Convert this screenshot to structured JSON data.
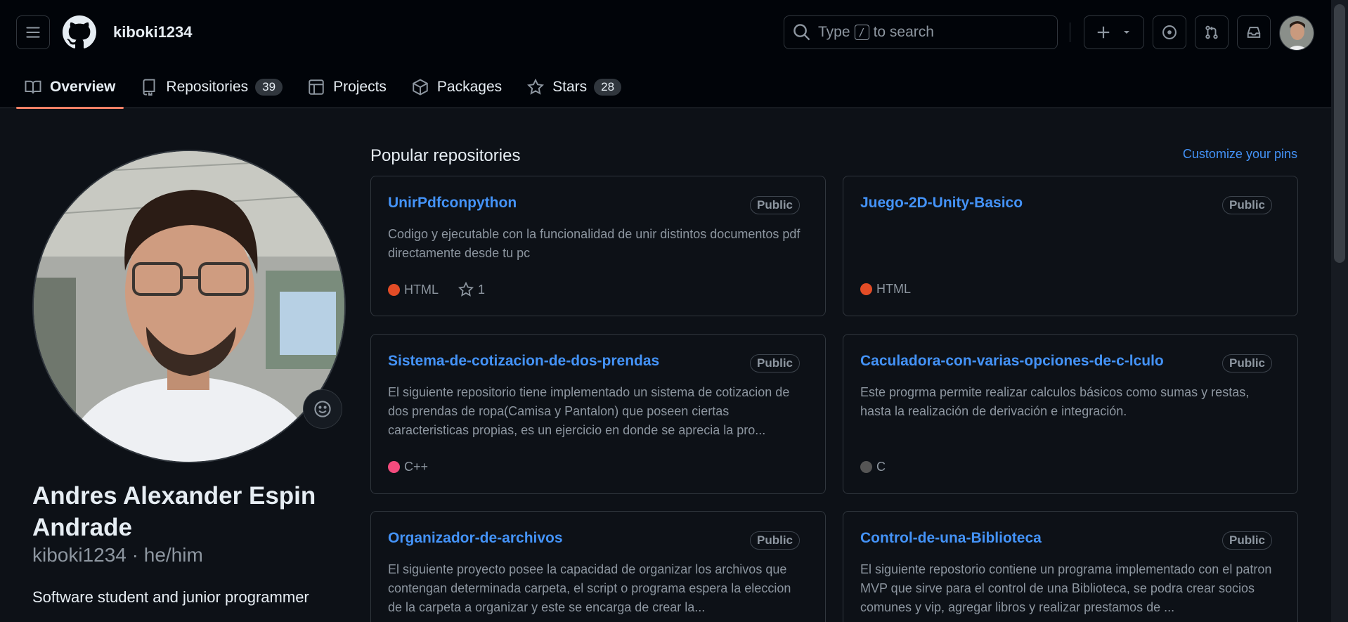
{
  "header": {
    "username": "kiboki1234",
    "search": {
      "prefix": "Type",
      "key": "/",
      "suffix": "to search"
    }
  },
  "tabs": [
    {
      "label": "Overview",
      "icon": "book-icon"
    },
    {
      "label": "Repositories",
      "icon": "repo-icon",
      "count": "39"
    },
    {
      "label": "Projects",
      "icon": "table-icon"
    },
    {
      "label": "Packages",
      "icon": "package-icon"
    },
    {
      "label": "Stars",
      "icon": "star-icon",
      "count": "28"
    }
  ],
  "profile": {
    "full_name": "Andres Alexander Espin Andrade",
    "handle": "kiboki1234 · he/him",
    "bio": "Software student and junior programmer"
  },
  "popular": {
    "title": "Popular repositories",
    "customize": "Customize your pins",
    "repos": [
      {
        "name": "UnirPdfconpython",
        "visibility": "Public",
        "description": "Codigo y ejecutable con la funcionalidad de unir distintos documentos pdf directamente desde tu pc",
        "language": "HTML",
        "lang_color": "#e34c26",
        "stars": "1"
      },
      {
        "name": "Juego-2D-Unity-Basico",
        "visibility": "Public",
        "description": "",
        "language": "HTML",
        "lang_color": "#e34c26"
      },
      {
        "name": "Sistema-de-cotizacion-de-dos-prendas",
        "visibility": "Public",
        "description": "El siguiente repositorio tiene implementado un sistema de cotizacion de dos prendas de ropa(Camisa y Pantalon) que poseen ciertas caracteristicas propias, es un ejercicio en donde se aprecia la pro...",
        "language": "C++",
        "lang_color": "#f34b7d"
      },
      {
        "name": "Caculadora-con-varias-opciones-de-c-lculo",
        "visibility": "Public",
        "description": "Este progrma permite realizar calculos básicos como sumas y restas, hasta la realización de derivación e integración.",
        "language": "C",
        "lang_color": "#555555"
      },
      {
        "name": "Organizador-de-archivos",
        "visibility": "Public",
        "description": "El siguiente proyecto posee la capacidad de organizar los archivos que contengan determinada carpeta, el script o programa espera la eleccion de la carpeta a organizar y este se encarga de crear la..."
      },
      {
        "name": "Control-de-una-Biblioteca",
        "visibility": "Public",
        "description": "El siguiente repostorio contiene un programa implementado con el patron MVP que sirve para el control de una Biblioteca, se podra crear socios comunes y vip, agregar libros y realizar prestamos de ..."
      }
    ]
  },
  "colors": {
    "accent": "#4493f8",
    "tab_underline": "#f78166",
    "background": "#0d1117",
    "header_bg": "#010409"
  }
}
